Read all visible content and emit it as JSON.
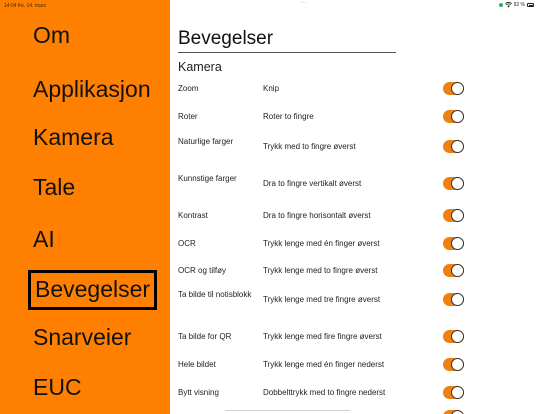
{
  "status_bar": {
    "time_date": "14:04 fre. 14. mars",
    "dots": "···",
    "battery_text": "92 %"
  },
  "sidebar": {
    "items": [
      {
        "label": "Om",
        "selected": false
      },
      {
        "label": "Applikasjon",
        "selected": false
      },
      {
        "label": "Kamera",
        "selected": false
      },
      {
        "label": "Tale",
        "selected": false
      },
      {
        "label": "AI",
        "selected": false
      },
      {
        "label": "Bevegelser",
        "selected": true
      },
      {
        "label": "Snarveier",
        "selected": false
      },
      {
        "label": "EUC",
        "selected": false
      }
    ],
    "background_color": "#ff8000"
  },
  "main": {
    "title": "Bevegelser",
    "section": "Kamera",
    "rows": [
      {
        "name": "Zoom",
        "desc": "Knip",
        "on": true
      },
      {
        "name": "Roter",
        "desc": "Roter to fingre",
        "on": true
      },
      {
        "name": "Naturlige farger",
        "desc": "Trykk med to fingre øverst",
        "on": true
      },
      {
        "name": "Kunnstige farger",
        "desc": "Dra to fingre vertikalt øverst",
        "on": true
      },
      {
        "name": "Kontrast",
        "desc": "Dra to fingre horisontalt øverst",
        "on": true
      },
      {
        "name": "OCR",
        "desc": "Trykk lenge med én finger øverst",
        "on": true
      },
      {
        "name": "OCR og tilføy",
        "desc": "Trykk lenge med to fingre øverst",
        "on": true
      },
      {
        "name": "Ta bilde til notisblokk",
        "desc": "Trykk lenge med tre fingre øverst",
        "on": true
      },
      {
        "name": "Ta bilde for QR",
        "desc": "Trykk lenge med fire fingre øverst",
        "on": true
      },
      {
        "name": "Hele bildet",
        "desc": "Trykk lenge med én finger nederst",
        "on": true
      },
      {
        "name": "Bytt visning",
        "desc": "Dobbelttrykk med to fingre nederst",
        "on": true
      }
    ],
    "toggle_color": "#f08010"
  }
}
